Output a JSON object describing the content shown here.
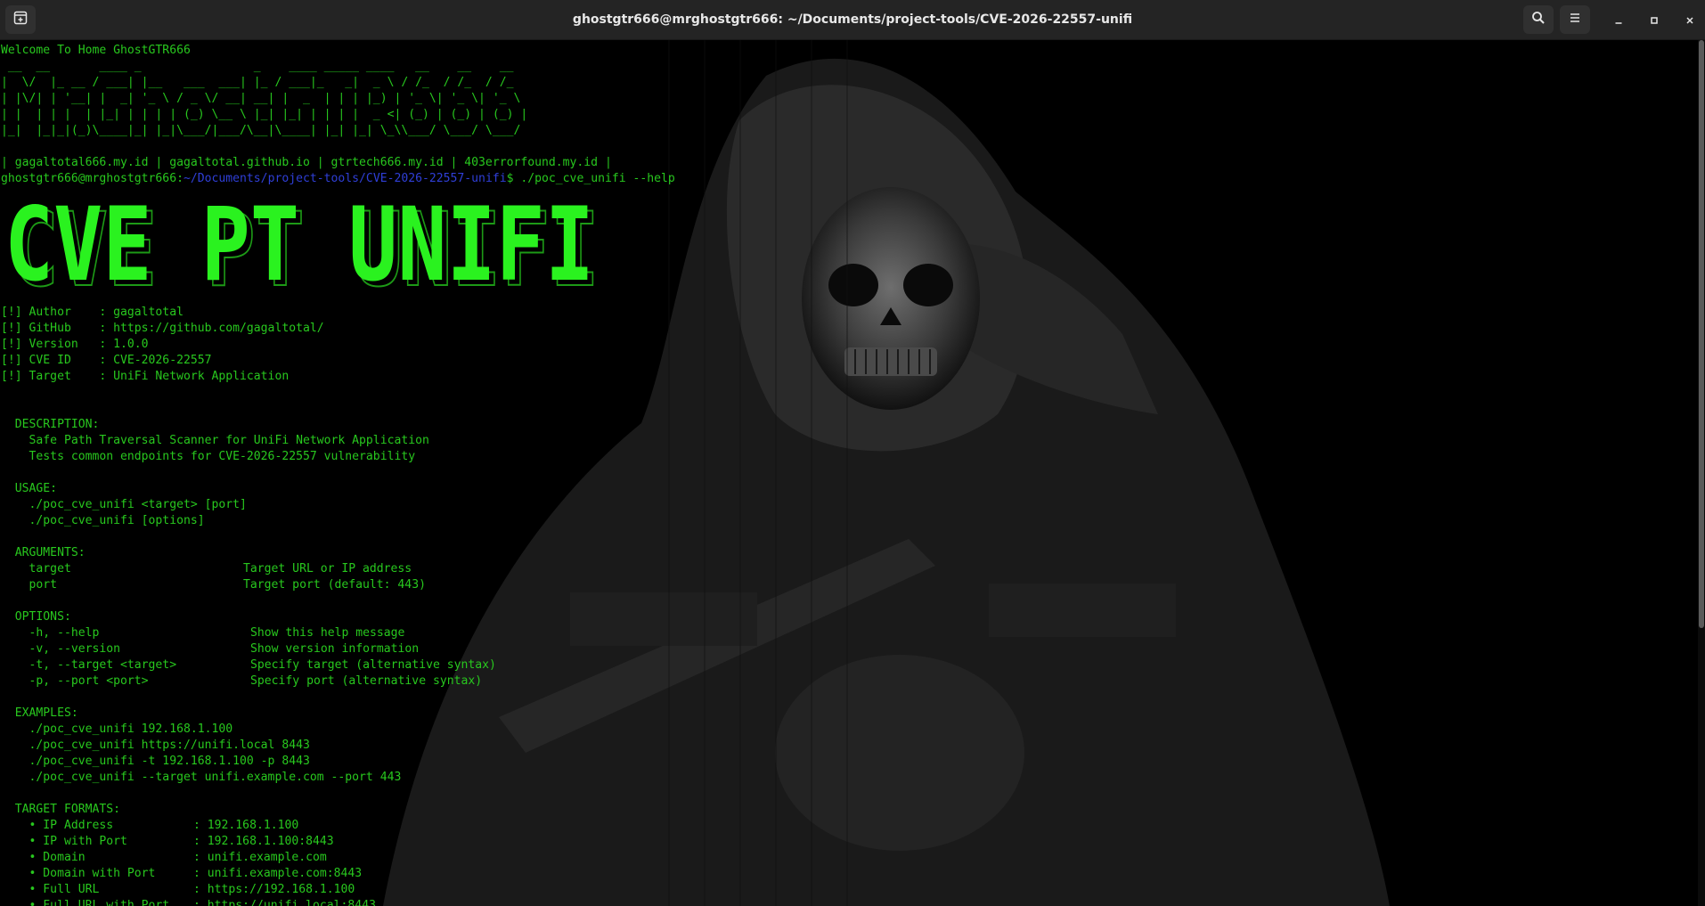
{
  "window": {
    "title": "ghostgtr666@mrghostgtr666: ~/Documents/project-tools/CVE-2026-22557-unifi"
  },
  "icons": {
    "new_tab": "new-tab-icon",
    "search": "search-icon",
    "menu": "hamburger-menu-icon",
    "minimize": "minimize-icon",
    "maximize": "maximize-icon",
    "close": "close-icon"
  },
  "colors": {
    "green": "#28c81e",
    "path_blue": "#2f3fd8",
    "titlebar": "#242424"
  },
  "terminal": {
    "welcome": "Welcome To Home GhostGTR666",
    "ascii_logo": [
      " __  __       ____ _                _    ____ _____ ____   __    __    __",
      "|  \\/  |_ __ / ___| |__   ___  ___| |_ / ___|_   _|  _ \\ / /_  / /_  / /_",
      "| |\\/| | '__| |  _| '_ \\ / _ \\/ __| __| |  _  | | | |_) | '_ \\| '_ \\| '_ \\",
      "| |  | | |  | |_| | | | | (_) \\__ \\ |_| |_| | | | |  _ <| (_) | (_) | (_) |",
      "|_|  |_|_|(_)\\____|_| |_|\\___/|___/\\__|\\____| |_| |_| \\_\\\\___/ \\___/ \\___/"
    ],
    "links": "| gagaltotal666.my.id | gagaltotal.github.io | gtrtech666.my.id | 403errorfound.my.id |",
    "prompt_user": "ghostgtr666@mrghostgtr666",
    "prompt_sep": ":",
    "prompt_path": "~/Documents/project-tools/CVE-2026-22557-unifi",
    "prompt_dollar": "$ ",
    "command": "./poc_cve_unifi --help",
    "banner_text": "CVE PT UNIFI",
    "info": [
      "[!] Author    : gagaltotal",
      "[!] GitHub    : https://github.com/gagaltotal/",
      "[!] Version   : 1.0.0",
      "[!] CVE ID    : CVE-2026-22557",
      "[!] Target    : UniFi Network Application"
    ],
    "description_head": "  DESCRIPTION:",
    "description": [
      "    Safe Path Traversal Scanner for UniFi Network Application",
      "    Tests common endpoints for CVE-2026-22557 vulnerability"
    ],
    "usage_head": "  USAGE:",
    "usage": [
      "    ./poc_cve_unifi <target> [port]",
      "    ./poc_cve_unifi [options]"
    ],
    "arguments_head": "  ARGUMENTS:",
    "arguments": [
      {
        "name": "    target",
        "desc": "Target URL or IP address"
      },
      {
        "name": "    port",
        "desc": "Target port (default: 443)"
      }
    ],
    "options_head": "  OPTIONS:",
    "options": [
      {
        "flag": "    -h, --help",
        "desc": "Show this help message"
      },
      {
        "flag": "    -v, --version",
        "desc": "Show version information"
      },
      {
        "flag": "    -t, --target <target>",
        "desc": "Specify target (alternative syntax)"
      },
      {
        "flag": "    -p, --port <port>",
        "desc": "Specify port (alternative syntax)"
      }
    ],
    "examples_head": "  EXAMPLES:",
    "examples": [
      "    ./poc_cve_unifi 192.168.1.100",
      "    ./poc_cve_unifi https://unifi.local 8443",
      "    ./poc_cve_unifi -t 192.168.1.100 -p 8443",
      "    ./poc_cve_unifi --target unifi.example.com --port 443"
    ],
    "formats_head": "  TARGET FORMATS:",
    "formats": [
      {
        "name": "    • IP Address",
        "value": ": 192.168.1.100"
      },
      {
        "name": "    • IP with Port",
        "value": ": 192.168.1.100:8443"
      },
      {
        "name": "    • Domain",
        "value": ": unifi.example.com"
      },
      {
        "name": "    • Domain with Port",
        "value": ": unifi.example.com:8443"
      },
      {
        "name": "    • Full URL",
        "value": ": https://192.168.1.100"
      },
      {
        "name": "    • Full URL with Port",
        "value": ": https://unifi.local:8443"
      }
    ]
  }
}
